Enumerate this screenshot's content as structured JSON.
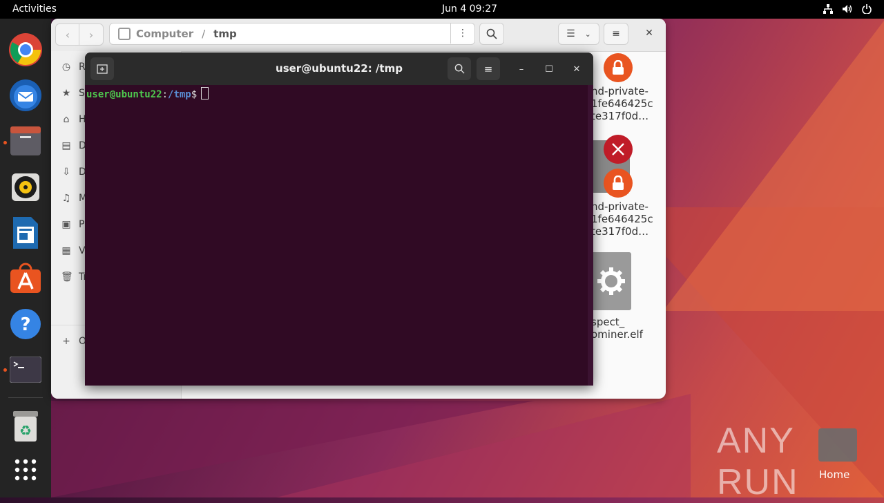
{
  "topbar": {
    "activities": "Activities",
    "clock": "Jun 4  09:27",
    "tray_icons": [
      "network-icon",
      "volume-icon",
      "power-icon"
    ]
  },
  "dock": {
    "items": [
      {
        "name": "chrome",
        "icon": "chrome-icon",
        "running": false
      },
      {
        "name": "thunderbird",
        "icon": "thunderbird-icon",
        "running": false
      },
      {
        "name": "files",
        "icon": "files-icon",
        "running": true
      },
      {
        "name": "rhythmbox",
        "icon": "rhythmbox-icon",
        "running": false
      },
      {
        "name": "libreoffice-writer",
        "icon": "writer-icon",
        "running": false
      },
      {
        "name": "app-center",
        "icon": "app-center-icon",
        "running": false
      },
      {
        "name": "help",
        "icon": "help-icon",
        "running": false
      },
      {
        "name": "terminal",
        "icon": "terminal-icon",
        "running": true
      },
      {
        "name": "trash",
        "icon": "trash-icon",
        "running": false
      },
      {
        "name": "show-apps",
        "icon": "grid-icon",
        "running": false
      }
    ]
  },
  "files": {
    "path_root": "Computer",
    "path_sep": "/",
    "path_current": "tmp",
    "sidebar": [
      {
        "label": "R",
        "icon": "clock-icon"
      },
      {
        "label": "S",
        "icon": "star-icon"
      },
      {
        "label": "H",
        "icon": "home-icon"
      },
      {
        "label": "D",
        "icon": "document-icon"
      },
      {
        "label": "D",
        "icon": "download-icon"
      },
      {
        "label": "M",
        "icon": "music-icon"
      },
      {
        "label": "Pi",
        "icon": "picture-icon"
      },
      {
        "label": "Vi",
        "icon": "video-icon"
      },
      {
        "label": "Tr",
        "icon": "trash-icon"
      },
      {
        "label": "O",
        "icon": "plus-icon"
      }
    ],
    "file_labels": [
      [
        "nd-private-",
        "1fe646425c",
        "te317f0d…"
      ],
      [
        "nd-private-",
        "1fe646425c",
        "te317f0d…"
      ],
      [
        "spect_",
        "ominer.elf"
      ]
    ]
  },
  "terminal": {
    "title": "user@ubuntu22: /tmp",
    "prompt_user": "user@ubuntu22",
    "prompt_colon": ":",
    "prompt_path": "/tmp",
    "prompt_symbol": "$"
  },
  "desktop": {
    "home_label": "Home",
    "watermark": "ANY RUN"
  },
  "colors": {
    "accent": "#e95420",
    "terminal_bg": "#300a24",
    "prompt_user": "#4ec94e",
    "prompt_path": "#5a8fd6"
  }
}
